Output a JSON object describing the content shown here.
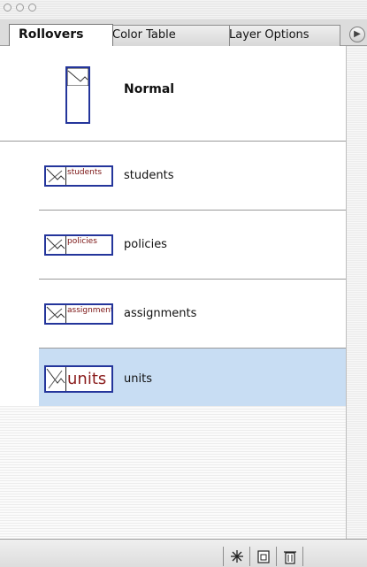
{
  "window": {
    "title": ""
  },
  "tabs": [
    {
      "label": "Rollovers",
      "active": true
    },
    {
      "label": "Color Table",
      "active": false
    },
    {
      "label": "Layer Options",
      "active": false
    }
  ],
  "normal_state": {
    "label": "Normal"
  },
  "rollovers": [
    {
      "label": "students",
      "thumb_text": "students",
      "selected": false
    },
    {
      "label": "policies",
      "thumb_text": "policies",
      "selected": false
    },
    {
      "label": "assignments",
      "thumb_text": "assignments",
      "selected": false
    },
    {
      "label": "units",
      "thumb_text": "units",
      "selected": true
    }
  ],
  "bottom_toolbar": {
    "buttons": [
      "new-rollover-icon",
      "new-document-icon",
      "trash-icon"
    ]
  },
  "colors": {
    "selection": "#c8ddf3",
    "thumb_border": "#24359b",
    "thumb_text": "#7a1212"
  }
}
